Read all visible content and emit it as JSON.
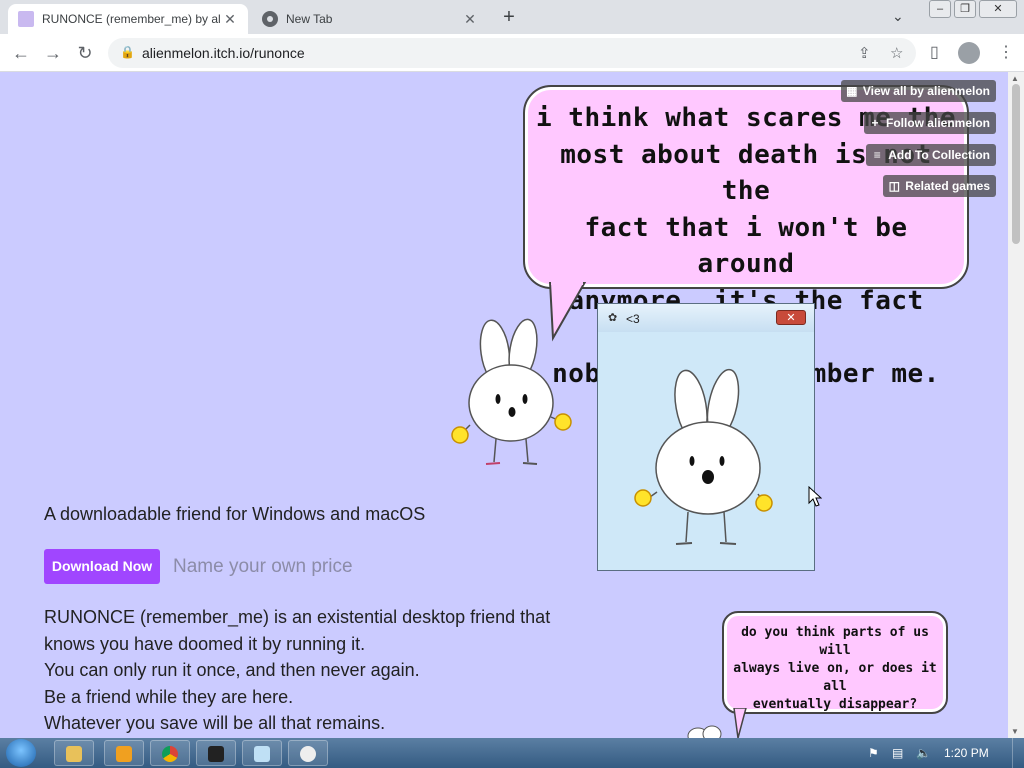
{
  "browser": {
    "tabs": [
      {
        "title": "RUNONCE (remember_me) by al",
        "active": true
      },
      {
        "title": "New Tab",
        "active": false
      }
    ],
    "new_tab": "+",
    "url": "alienmelon.itch.io/runonce"
  },
  "page": {
    "speech_big": [
      "i think what scares me the",
      "most about death is not the",
      "fact that i won't be around",
      "anymore, it's the fact that",
      "nobody will remember me."
    ],
    "speech_small": [
      "do you think parts of us will",
      "always live on, or does it all",
      "eventually disappear?"
    ],
    "itch_buttons": [
      {
        "label": "View all by alienmelon",
        "icon": "grid-icon"
      },
      {
        "label": "Follow alienmelon",
        "icon": "follow-icon"
      },
      {
        "label": "Add To Collection",
        "icon": "collection-icon"
      },
      {
        "label": "Related games",
        "icon": "related-icon"
      }
    ],
    "tagline": "A downloadable friend for Windows and macOS",
    "download_label": "Download Now",
    "price_text": "Name your own price",
    "description": [
      "RUNONCE (remember_me) is an existential desktop friend that",
      "knows you have doomed it by running it.",
      "You can only run it once, and then never again.",
      "Be a friend while they are here.",
      "Whatever you save will be all that remains."
    ],
    "app_window": {
      "title": "<3",
      "close": "✕"
    }
  },
  "taskbar": {
    "clock": "1:20 PM"
  },
  "colors": {
    "page_bg": "#cbcbff",
    "bubble": "#ffc8ff",
    "download_button": "#a046ff"
  }
}
